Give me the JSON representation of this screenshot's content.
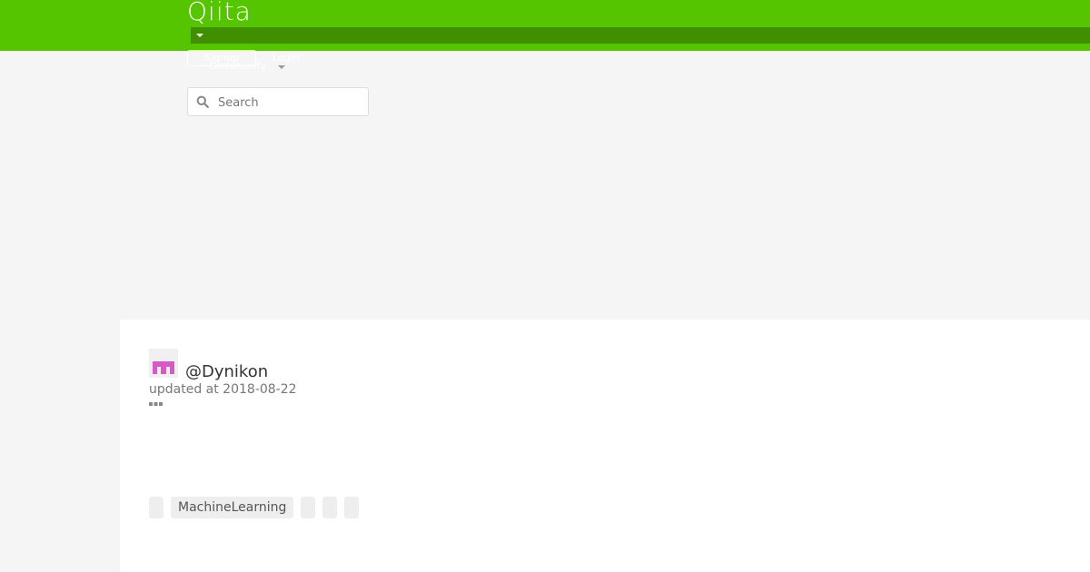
{
  "header": {
    "logo_text": "Qiita",
    "signup_label": "Signup",
    "login_label": "Login",
    "community_label": "Community"
  },
  "search": {
    "placeholder": "Search"
  },
  "article": {
    "author": "@Dynikon",
    "updated": "updated at 2018-08-22",
    "tags": [
      "",
      "MachineLearning",
      "",
      "",
      ""
    ]
  },
  "colors": {
    "brand_green": "#55c500",
    "dark_green": "#3f8f00",
    "avatar_pink": "#d65ac6"
  },
  "icons": [
    "chevron-down-icon",
    "search-icon",
    "avatar-identicon",
    "more-dots-icon"
  ]
}
